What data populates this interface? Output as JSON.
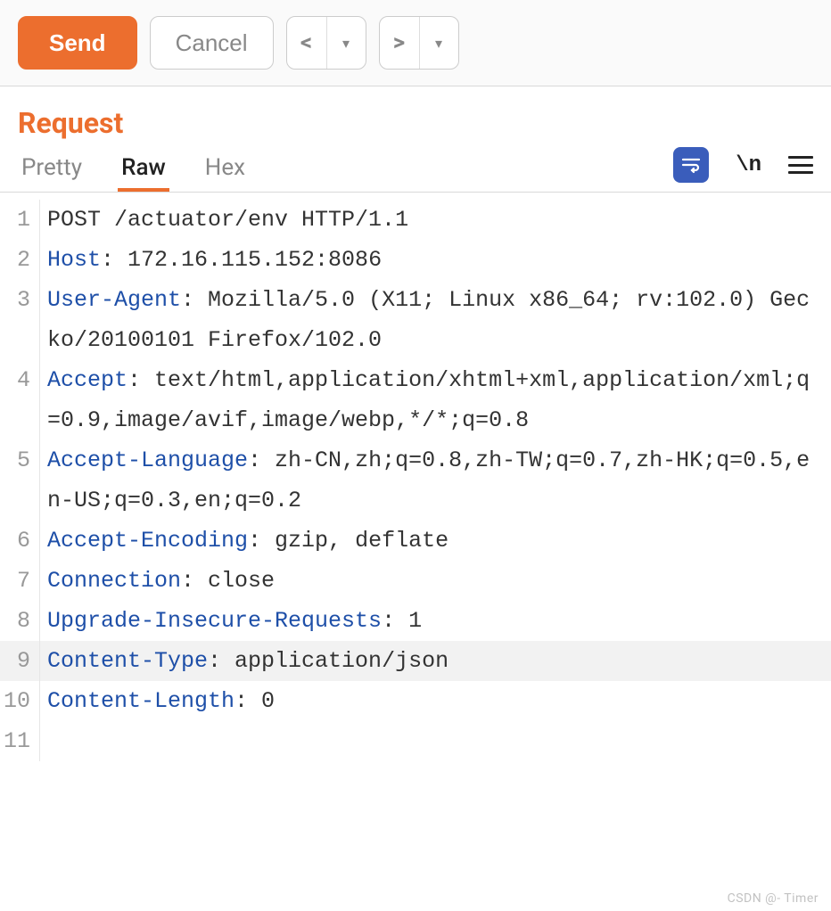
{
  "toolbar": {
    "send_label": "Send",
    "cancel_label": "Cancel",
    "prev_symbol": "<",
    "next_symbol": ">",
    "dropdown_symbol": "▾"
  },
  "section_title": "Request",
  "tabs": {
    "pretty": "Pretty",
    "raw": "Raw",
    "hex": "Hex",
    "active": "Raw"
  },
  "tools": {
    "newline_label": "\\n"
  },
  "request": {
    "first_line": "POST /actuator/env HTTP/1.1",
    "headers": [
      {
        "name": "Host",
        "value": "172.16.115.152:8086"
      },
      {
        "name": "User-Agent",
        "value": "Mozilla/5.0 (X11; Linux x86_64; rv:102.0) Gecko/20100101 Firefox/102.0"
      },
      {
        "name": "Accept",
        "value": "text/html,application/xhtml+xml,application/xml;q=0.9,image/avif,image/webp,*/*;q=0.8"
      },
      {
        "name": "Accept-Language",
        "value": "zh-CN,zh;q=0.8,zh-TW;q=0.7,zh-HK;q=0.5,en-US;q=0.3,en;q=0.2"
      },
      {
        "name": "Accept-Encoding",
        "value": "gzip, deflate"
      },
      {
        "name": "Connection",
        "value": "close"
      },
      {
        "name": "Upgrade-Insecure-Requests",
        "value": "1"
      },
      {
        "name": "Content-Type",
        "value": "application/json"
      },
      {
        "name": "Content-Length",
        "value": "0"
      }
    ],
    "highlighted_line": 9,
    "total_lines": 11
  },
  "watermark": "CSDN @- Timer"
}
